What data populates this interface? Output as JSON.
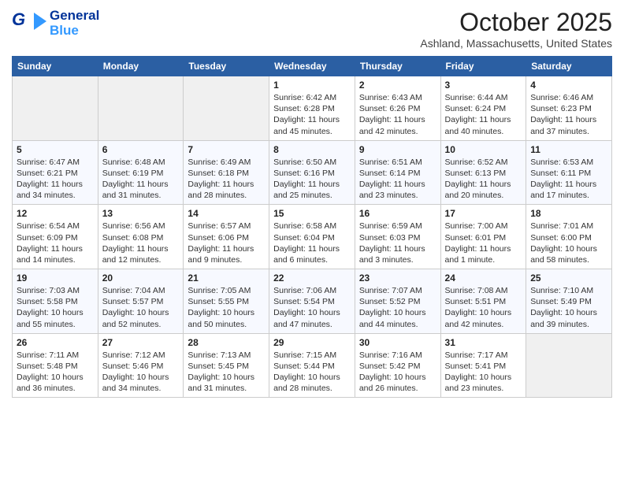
{
  "header": {
    "logo_general": "General",
    "logo_blue": "Blue",
    "title": "October 2025",
    "location": "Ashland, Massachusetts, United States"
  },
  "weekdays": [
    "Sunday",
    "Monday",
    "Tuesday",
    "Wednesday",
    "Thursday",
    "Friday",
    "Saturday"
  ],
  "weeks": [
    [
      {
        "day": "",
        "empty": true
      },
      {
        "day": "",
        "empty": true
      },
      {
        "day": "",
        "empty": true
      },
      {
        "day": "1",
        "sunrise": "Sunrise: 6:42 AM",
        "sunset": "Sunset: 6:28 PM",
        "daylight": "Daylight: 11 hours and 45 minutes."
      },
      {
        "day": "2",
        "sunrise": "Sunrise: 6:43 AM",
        "sunset": "Sunset: 6:26 PM",
        "daylight": "Daylight: 11 hours and 42 minutes."
      },
      {
        "day": "3",
        "sunrise": "Sunrise: 6:44 AM",
        "sunset": "Sunset: 6:24 PM",
        "daylight": "Daylight: 11 hours and 40 minutes."
      },
      {
        "day": "4",
        "sunrise": "Sunrise: 6:46 AM",
        "sunset": "Sunset: 6:23 PM",
        "daylight": "Daylight: 11 hours and 37 minutes."
      }
    ],
    [
      {
        "day": "5",
        "sunrise": "Sunrise: 6:47 AM",
        "sunset": "Sunset: 6:21 PM",
        "daylight": "Daylight: 11 hours and 34 minutes."
      },
      {
        "day": "6",
        "sunrise": "Sunrise: 6:48 AM",
        "sunset": "Sunset: 6:19 PM",
        "daylight": "Daylight: 11 hours and 31 minutes."
      },
      {
        "day": "7",
        "sunrise": "Sunrise: 6:49 AM",
        "sunset": "Sunset: 6:18 PM",
        "daylight": "Daylight: 11 hours and 28 minutes."
      },
      {
        "day": "8",
        "sunrise": "Sunrise: 6:50 AM",
        "sunset": "Sunset: 6:16 PM",
        "daylight": "Daylight: 11 hours and 25 minutes."
      },
      {
        "day": "9",
        "sunrise": "Sunrise: 6:51 AM",
        "sunset": "Sunset: 6:14 PM",
        "daylight": "Daylight: 11 hours and 23 minutes."
      },
      {
        "day": "10",
        "sunrise": "Sunrise: 6:52 AM",
        "sunset": "Sunset: 6:13 PM",
        "daylight": "Daylight: 11 hours and 20 minutes."
      },
      {
        "day": "11",
        "sunrise": "Sunrise: 6:53 AM",
        "sunset": "Sunset: 6:11 PM",
        "daylight": "Daylight: 11 hours and 17 minutes."
      }
    ],
    [
      {
        "day": "12",
        "sunrise": "Sunrise: 6:54 AM",
        "sunset": "Sunset: 6:09 PM",
        "daylight": "Daylight: 11 hours and 14 minutes."
      },
      {
        "day": "13",
        "sunrise": "Sunrise: 6:56 AM",
        "sunset": "Sunset: 6:08 PM",
        "daylight": "Daylight: 11 hours and 12 minutes."
      },
      {
        "day": "14",
        "sunrise": "Sunrise: 6:57 AM",
        "sunset": "Sunset: 6:06 PM",
        "daylight": "Daylight: 11 hours and 9 minutes."
      },
      {
        "day": "15",
        "sunrise": "Sunrise: 6:58 AM",
        "sunset": "Sunset: 6:04 PM",
        "daylight": "Daylight: 11 hours and 6 minutes."
      },
      {
        "day": "16",
        "sunrise": "Sunrise: 6:59 AM",
        "sunset": "Sunset: 6:03 PM",
        "daylight": "Daylight: 11 hours and 3 minutes."
      },
      {
        "day": "17",
        "sunrise": "Sunrise: 7:00 AM",
        "sunset": "Sunset: 6:01 PM",
        "daylight": "Daylight: 11 hours and 1 minute."
      },
      {
        "day": "18",
        "sunrise": "Sunrise: 7:01 AM",
        "sunset": "Sunset: 6:00 PM",
        "daylight": "Daylight: 10 hours and 58 minutes."
      }
    ],
    [
      {
        "day": "19",
        "sunrise": "Sunrise: 7:03 AM",
        "sunset": "Sunset: 5:58 PM",
        "daylight": "Daylight: 10 hours and 55 minutes."
      },
      {
        "day": "20",
        "sunrise": "Sunrise: 7:04 AM",
        "sunset": "Sunset: 5:57 PM",
        "daylight": "Daylight: 10 hours and 52 minutes."
      },
      {
        "day": "21",
        "sunrise": "Sunrise: 7:05 AM",
        "sunset": "Sunset: 5:55 PM",
        "daylight": "Daylight: 10 hours and 50 minutes."
      },
      {
        "day": "22",
        "sunrise": "Sunrise: 7:06 AM",
        "sunset": "Sunset: 5:54 PM",
        "daylight": "Daylight: 10 hours and 47 minutes."
      },
      {
        "day": "23",
        "sunrise": "Sunrise: 7:07 AM",
        "sunset": "Sunset: 5:52 PM",
        "daylight": "Daylight: 10 hours and 44 minutes."
      },
      {
        "day": "24",
        "sunrise": "Sunrise: 7:08 AM",
        "sunset": "Sunset: 5:51 PM",
        "daylight": "Daylight: 10 hours and 42 minutes."
      },
      {
        "day": "25",
        "sunrise": "Sunrise: 7:10 AM",
        "sunset": "Sunset: 5:49 PM",
        "daylight": "Daylight: 10 hours and 39 minutes."
      }
    ],
    [
      {
        "day": "26",
        "sunrise": "Sunrise: 7:11 AM",
        "sunset": "Sunset: 5:48 PM",
        "daylight": "Daylight: 10 hours and 36 minutes."
      },
      {
        "day": "27",
        "sunrise": "Sunrise: 7:12 AM",
        "sunset": "Sunset: 5:46 PM",
        "daylight": "Daylight: 10 hours and 34 minutes."
      },
      {
        "day": "28",
        "sunrise": "Sunrise: 7:13 AM",
        "sunset": "Sunset: 5:45 PM",
        "daylight": "Daylight: 10 hours and 31 minutes."
      },
      {
        "day": "29",
        "sunrise": "Sunrise: 7:15 AM",
        "sunset": "Sunset: 5:44 PM",
        "daylight": "Daylight: 10 hours and 28 minutes."
      },
      {
        "day": "30",
        "sunrise": "Sunrise: 7:16 AM",
        "sunset": "Sunset: 5:42 PM",
        "daylight": "Daylight: 10 hours and 26 minutes."
      },
      {
        "day": "31",
        "sunrise": "Sunrise: 7:17 AM",
        "sunset": "Sunset: 5:41 PM",
        "daylight": "Daylight: 10 hours and 23 minutes."
      },
      {
        "day": "",
        "empty": true
      }
    ]
  ]
}
